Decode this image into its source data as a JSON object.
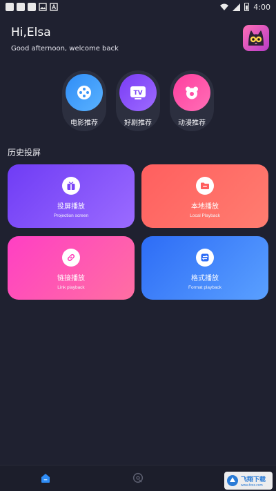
{
  "status_bar": {
    "time": "4:00",
    "icons": [
      "notification-square-icon",
      "notification-square-icon",
      "notification-square-icon",
      "image-icon",
      "font-icon"
    ],
    "right_icons": [
      "wifi-icon",
      "signal-icon",
      "battery-icon"
    ]
  },
  "header": {
    "greeting": "Hi,Elsa",
    "subtitle": "Good afternoon, welcome back"
  },
  "recommend": [
    {
      "label": "电影推荐",
      "icon": "film-reel-icon",
      "color_from": "#2f8df7",
      "color_to": "#5ab2ff"
    },
    {
      "label": "好剧推荐",
      "icon": "tv-icon",
      "color_from": "#7a3cf5",
      "color_to": "#9d6bff"
    },
    {
      "label": "动漫推荐",
      "icon": "bear-icon",
      "color_from": "#ff3e9f",
      "color_to": "#ff6fb6"
    }
  ],
  "section": {
    "title": "历史投屏"
  },
  "cards": [
    {
      "title": "投屏播放",
      "subtitle": "Projection screen",
      "icon": "gift-box-icon",
      "accent": "#7b46f7"
    },
    {
      "title": "本地播放",
      "subtitle": "Local Playback",
      "icon": "folder-icon",
      "accent": "#ff5f5f"
    },
    {
      "title": "链接播放",
      "subtitle": "Link playback",
      "icon": "link-icon",
      "accent": "#ff3fb8"
    },
    {
      "title": "格式播放",
      "subtitle": "Format playback",
      "icon": "swap-icon",
      "accent": "#2d6cf6"
    }
  ],
  "bottom_nav": [
    {
      "icon": "home-icon",
      "active": true,
      "color": "#2f8df7"
    },
    {
      "icon": "discover-icon",
      "active": false,
      "color": "#5a5d6e"
    }
  ],
  "watermark": {
    "cn": "飞翔下载",
    "url": "www.fxxz.com"
  }
}
